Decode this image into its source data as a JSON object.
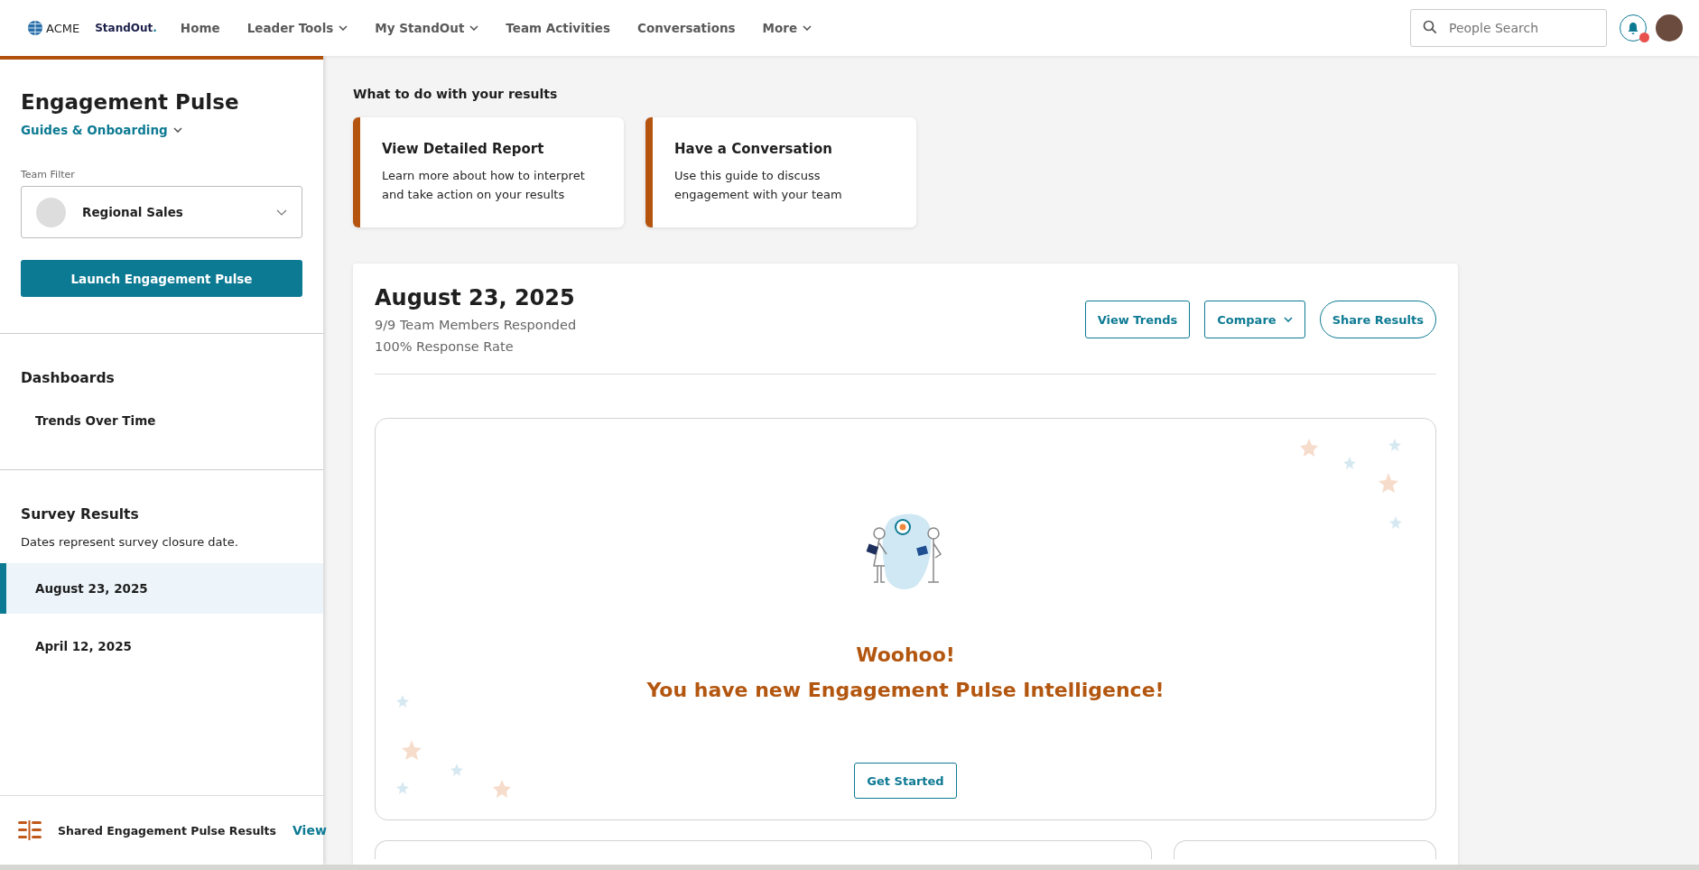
{
  "header": {
    "logo_text": "ACME",
    "product": "StandOut",
    "product_mark": ".",
    "nav": [
      {
        "label": "Home",
        "has_menu": false
      },
      {
        "label": "Leader Tools",
        "has_menu": true
      },
      {
        "label": "My StandOut",
        "has_menu": true
      },
      {
        "label": "Team Activities",
        "has_menu": false
      },
      {
        "label": "Conversations",
        "has_menu": false
      },
      {
        "label": "More",
        "has_menu": true
      }
    ],
    "search": {
      "placeholder": "People Search"
    },
    "notifications": {
      "unread": true
    }
  },
  "sidebar": {
    "title": "Engagement Pulse",
    "guides_link": "Guides & Onboarding",
    "team_filter": {
      "label": "Team Filter",
      "value": "Regional Sales"
    },
    "launch_button": "Launch Engagement Pulse",
    "dashboards": {
      "heading": "Dashboards",
      "items": [
        {
          "label": "Trends Over Time"
        }
      ]
    },
    "survey_results": {
      "heading": "Survey Results",
      "note": "Dates represent survey closure date.",
      "items": [
        {
          "label": "August 23, 2025",
          "selected": true
        },
        {
          "label": "April 12, 2025",
          "selected": false
        }
      ]
    },
    "shared": {
      "label": "Shared Engagement Pulse Results",
      "link": "View"
    }
  },
  "main": {
    "actions_heading": "What to do with your results",
    "action_cards": [
      {
        "title": "View Detailed Report",
        "text": "Learn more about how to interpret and take action on your results"
      },
      {
        "title": "Have a Conversation",
        "text": "Use this guide to discuss engagement with your team"
      }
    ],
    "result": {
      "date": "August 23, 2025",
      "responded": "9/9 Team Members Responded",
      "rate": "100% Response Rate",
      "buttons": [
        {
          "label": "View Trends",
          "kind": "square"
        },
        {
          "label": "Compare",
          "kind": "menu"
        },
        {
          "label": "Share Results",
          "kind": "pill"
        }
      ],
      "promo": {
        "line_1": "Woohoo!",
        "line_2": "You have new Engagement Pulse Intelligence!",
        "button": "Get Started"
      }
    }
  }
}
